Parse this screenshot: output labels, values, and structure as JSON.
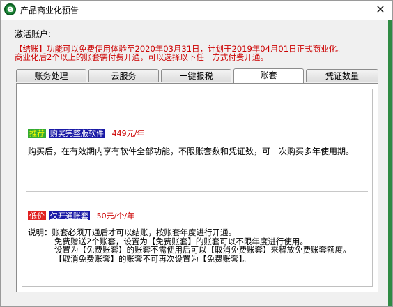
{
  "window": {
    "title": "产品商业化预告",
    "close_symbol": "✕",
    "icon_letter": "e"
  },
  "account": {
    "label": "激活账户:"
  },
  "notice": {
    "line1": "【结账】功能可以免费使用体验至2020年03月31日，计划于2019年04月01日正式商业化。",
    "line2": "商业化后2个以上的账套需付费开通，可以选择以下任一方式付费开通。"
  },
  "tabs": [
    {
      "label": "账务处理"
    },
    {
      "label": "云服务"
    },
    {
      "label": "一键报税"
    },
    {
      "label": "账套"
    },
    {
      "label": "凭证数量"
    }
  ],
  "active_tab": "账套",
  "option1": {
    "tag": "推荐",
    "button": "购买完整版软件",
    "price": "449元/年",
    "description": "购买后，在有效期内享有软件全部功能，不限账套数和凭证数，可一次购买多年使用期。"
  },
  "option2": {
    "tag": "低价",
    "button": "仅开通账套",
    "price": "50元/个/年"
  },
  "note": {
    "line1": "说明：账套必须开通后才可以结账，按账套年度进行开通。",
    "line2": "免费赠送2个账套，设置为【免费账套】的账套可以不限年度进行使用。",
    "line3": "设置为【免费账套】的账套不需使用后可以【取消免费账套】来释放免费账套额度。",
    "line4": "【取消免费账套】的账套不可再次设置为【免费账套】。"
  },
  "colors": {
    "notice_red": "#cc0000",
    "tag_green": "#33aa33",
    "tag_red": "#e02020",
    "link_blue": "#1a1aa6",
    "frame_green": "#2f8b44"
  }
}
